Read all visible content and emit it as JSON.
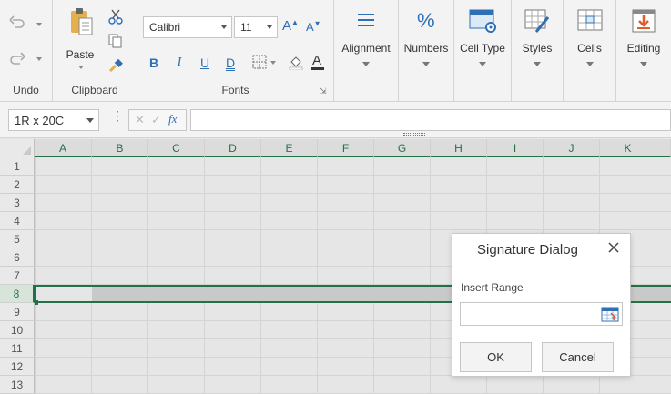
{
  "ribbon": {
    "undo": {
      "group_label": "Undo"
    },
    "clipboard": {
      "group_label": "Clipboard",
      "paste_label": "Paste"
    },
    "fonts": {
      "group_label": "Fonts",
      "font_name": "Calibri",
      "font_size": "11",
      "bold": "B",
      "italic": "I",
      "underline": "U",
      "double_underline": "D"
    },
    "alignment": {
      "label": "Alignment"
    },
    "numbers": {
      "label": "Numbers"
    },
    "cell_type": {
      "label": "Cell Type"
    },
    "styles": {
      "label": "Styles"
    },
    "cells": {
      "label": "Cells"
    },
    "editing": {
      "label": "Editing"
    }
  },
  "formula_bar": {
    "name_box": "1R x 20C",
    "fx": "fx",
    "formula": ""
  },
  "grid": {
    "columns": [
      "A",
      "B",
      "C",
      "D",
      "E",
      "F",
      "G",
      "H",
      "I",
      "J",
      "K"
    ],
    "rows": [
      "1",
      "2",
      "3",
      "4",
      "5",
      "6",
      "7",
      "8",
      "9",
      "10",
      "11",
      "12",
      "13"
    ],
    "selected_row": "8"
  },
  "dialog": {
    "title": "Signature Dialog",
    "field_label": "Insert Range",
    "field_value": "",
    "ok_label": "OK",
    "cancel_label": "Cancel"
  },
  "colors": {
    "accent_green": "#217346",
    "icon_blue": "#2f6fb5"
  }
}
